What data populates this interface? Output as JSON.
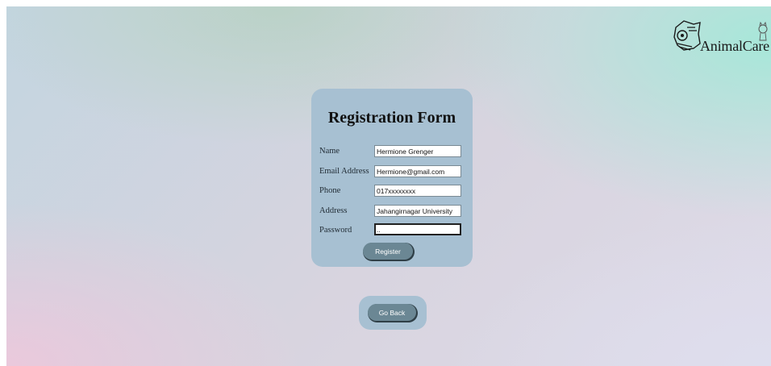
{
  "brand": {
    "logo_text": "AnimalCare",
    "logo_icon": "dog-and-cat-icon"
  },
  "form": {
    "title": "Registration Form",
    "fields": [
      {
        "label": "Name",
        "value": "Hermione Grenger",
        "type": "text"
      },
      {
        "label": "Email Address",
        "value": "Hermione@gmail.com",
        "type": "text"
      },
      {
        "label": "Phone",
        "value": "017xxxxxxxx",
        "type": "text"
      },
      {
        "label": "Address",
        "value": "Jahangirnagar University",
        "type": "text"
      },
      {
        "label": "Password",
        "value": "..",
        "type": "password"
      }
    ],
    "submit_label": "Register"
  },
  "navigation": {
    "go_back_label": "Go Back"
  },
  "colors": {
    "card_background": "#a7c0d2",
    "button_background": "#6b8794",
    "button_text": "#ffffff"
  }
}
